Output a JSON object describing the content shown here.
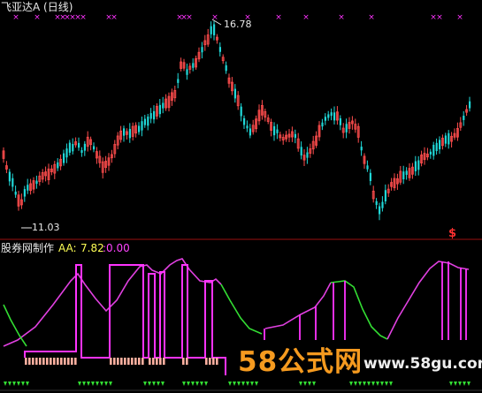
{
  "window": {
    "title": "飞亚达A (日线)"
  },
  "price_panel": {
    "high_label": "16.78",
    "low_label": "11.03",
    "signal_mark": "$",
    "colors": {
      "up": "#ff4d4d",
      "down": "#20d8d8",
      "marker": "#ff33ff",
      "ref_line": "#9a1010"
    }
  },
  "indicator_panel": {
    "title": "股券网制作",
    "aa_label": "AA:",
    "aa_value": "7.82",
    "secondary_value": ":0.00",
    "colors": {
      "pos_line": "#e040e0",
      "neg_line": "#33dd33",
      "step": "#ff33ff",
      "bar": "#ffb0a0",
      "arrow": "#33dd33"
    }
  },
  "watermark": {
    "brand": "58公式网",
    "url": "www.58gu.com"
  }
}
